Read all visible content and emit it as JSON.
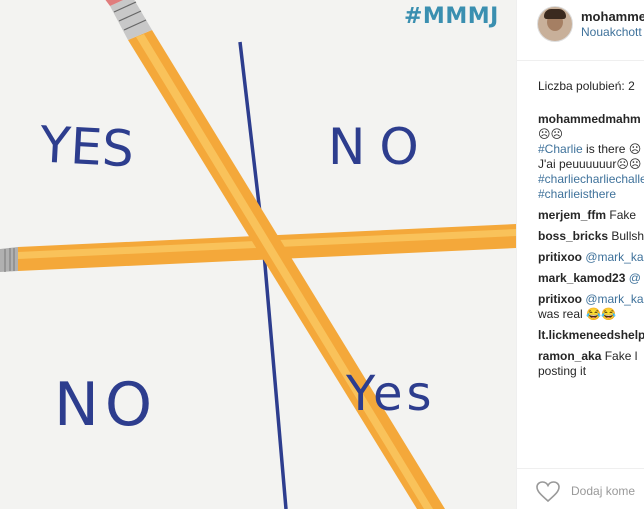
{
  "photo": {
    "hashtag": "#MMMJ",
    "grid_words": {
      "top_left": "YES",
      "top_right": "NO",
      "bottom_left": "NO",
      "bottom_right": "Yes"
    }
  },
  "post": {
    "username": "mohammedmahm",
    "location": "Nouakchott",
    "likes_label": "Liczba polubień: 2",
    "caption": {
      "username": "mohammedmahm",
      "emoji_line": "☹☹",
      "tag_charlie": "#Charlie",
      "text_is_there": " is there ☹",
      "text_jai": "J'ai peuuuuuur☹☹",
      "tag_challenge": "#charliecharliechallenge",
      "tag_isthere": "#charlieisthere"
    },
    "comments": [
      {
        "user": "merjem_ffm",
        "text": " Fake"
      },
      {
        "user": "boss_bricks",
        "text": " Bullsh"
      },
      {
        "user": "pritixoo",
        "mention": " @mark_ka"
      },
      {
        "user": "mark_kamod23",
        "mention": " @"
      },
      {
        "user": "pritixoo",
        "mention": " @mark_ka",
        "text2": "was real 😂😂"
      },
      {
        "user": "lt.lickmeneedshelp",
        "text": ""
      },
      {
        "user": "ramon_aka",
        "text": " Fake l",
        "text2": "posting it"
      }
    ],
    "add_comment_placeholder": "Dodaj kome"
  },
  "icons": {
    "like": "heart-icon"
  }
}
